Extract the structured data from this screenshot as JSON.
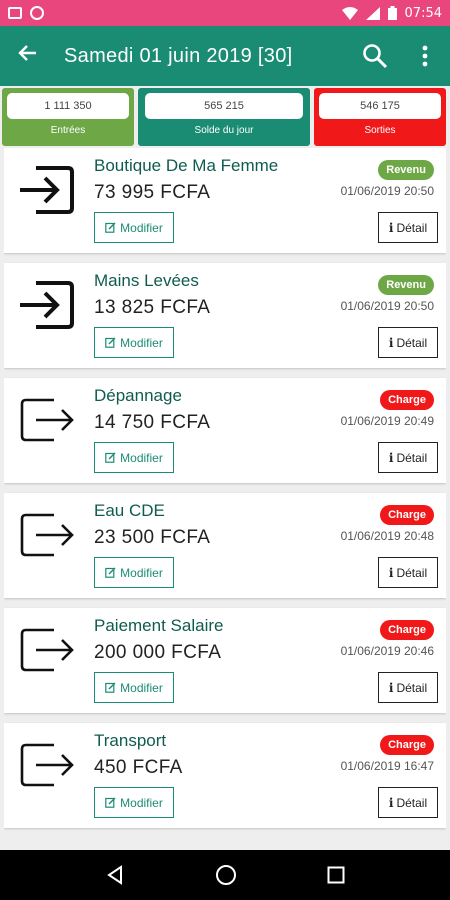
{
  "status_bar": {
    "time": "07:54"
  },
  "app_bar": {
    "title": "Samedi 01 juin 2019 [30]",
    "back_icon": "arrow-left-icon",
    "search_icon": "search-icon",
    "menu_icon": "more-vert-icon"
  },
  "summary": {
    "entrees": {
      "value": "1 111 350",
      "label": "Entrées"
    },
    "solde": {
      "value": "565 215",
      "label": "Solde du jour"
    },
    "sorties": {
      "value": "546 175",
      "label": "Sorties"
    }
  },
  "colors": {
    "primary": "#1a8c74",
    "revenue": "#6ea846",
    "charge": "#f01818",
    "status_bar": "#e8467c"
  },
  "labels": {
    "modify": "Modifier",
    "detail": "Détail"
  },
  "transactions": [
    {
      "name": "Boutique De Ma Femme",
      "amount": "73 995 FCFA",
      "type": "Revenu",
      "kind": "rev",
      "date": "01/06/2019 20:50"
    },
    {
      "name": "Mains Levées",
      "amount": "13 825 FCFA",
      "type": "Revenu",
      "kind": "rev",
      "date": "01/06/2019 20:50"
    },
    {
      "name": "Dépannage",
      "amount": "14 750 FCFA",
      "type": "Charge",
      "kind": "chg",
      "date": "01/06/2019 20:49"
    },
    {
      "name": "Eau CDE",
      "amount": "23 500 FCFA",
      "type": "Charge",
      "kind": "chg",
      "date": "01/06/2019 20:48"
    },
    {
      "name": "Paiement Salaire",
      "amount": "200 000 FCFA",
      "type": "Charge",
      "kind": "chg",
      "date": "01/06/2019 20:46"
    },
    {
      "name": "Transport",
      "amount": "450 FCFA",
      "type": "Charge",
      "kind": "chg",
      "date": "01/06/2019 16:47"
    }
  ]
}
